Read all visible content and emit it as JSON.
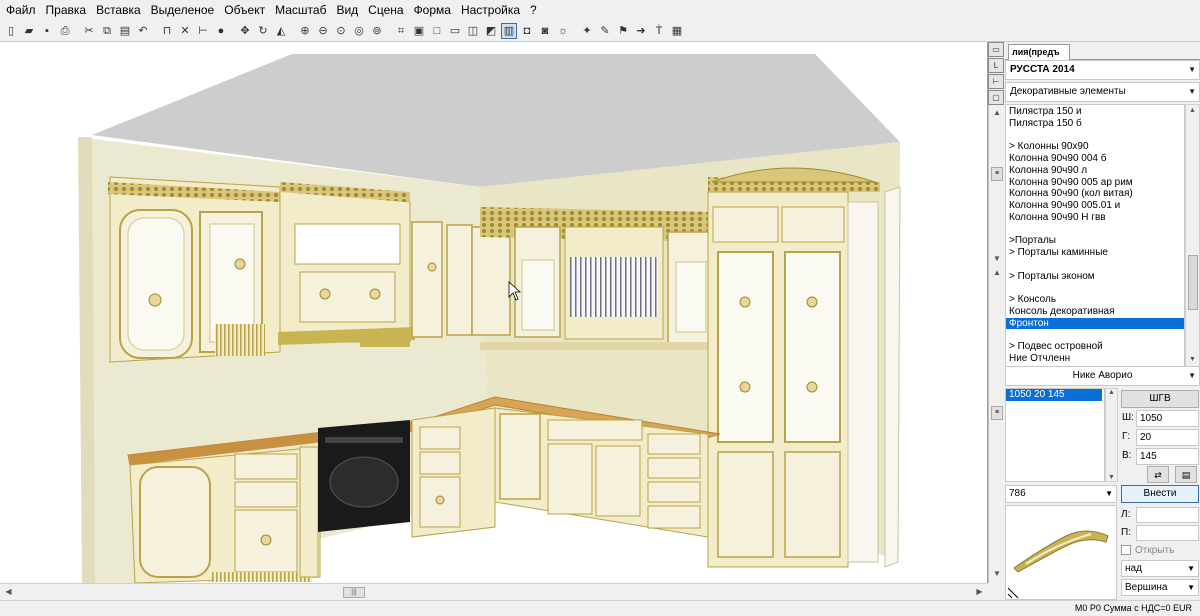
{
  "menu": [
    "Файл",
    "Правка",
    "Вставка",
    "Выделеное",
    "Объект",
    "Масштаб",
    "Вид",
    "Сцена",
    "Форма",
    "Настройка",
    "?"
  ],
  "toolbar": [
    {
      "icon": "new-icon",
      "glyph": "▯"
    },
    {
      "icon": "open-icon",
      "glyph": "▰"
    },
    {
      "icon": "save-icon",
      "glyph": "▪"
    },
    {
      "icon": "print-icon",
      "glyph": "⎙"
    },
    {
      "sep": true
    },
    {
      "icon": "cut-icon",
      "glyph": "✂"
    },
    {
      "icon": "copy-icon",
      "glyph": "⧉"
    },
    {
      "icon": "paste-icon",
      "glyph": "▤"
    },
    {
      "icon": "undo-icon",
      "glyph": "↶"
    },
    {
      "sep": true
    },
    {
      "icon": "snap-icon",
      "glyph": "⊓"
    },
    {
      "icon": "pin-icon",
      "glyph": "✕"
    },
    {
      "icon": "dimension-icon",
      "glyph": "⊢"
    },
    {
      "icon": "info-icon",
      "glyph": "●"
    },
    {
      "sep": true
    },
    {
      "icon": "move-icon",
      "glyph": "✥"
    },
    {
      "icon": "rotate-icon",
      "glyph": "↻"
    },
    {
      "icon": "mirror-icon",
      "glyph": "◭"
    },
    {
      "sep": true
    },
    {
      "icon": "zoom-in-icon",
      "glyph": "⊕"
    },
    {
      "icon": "zoom-out-icon",
      "glyph": "⊖"
    },
    {
      "icon": "zoom-window-icon",
      "glyph": "⊙"
    },
    {
      "icon": "zoom-all-icon",
      "glyph": "◎"
    },
    {
      "icon": "zoom-prev-icon",
      "glyph": "⊚"
    },
    {
      "sep": true
    },
    {
      "icon": "plan-view-icon",
      "glyph": "⌗"
    },
    {
      "icon": "front-view-icon",
      "glyph": "▣"
    },
    {
      "icon": "wireframe-icon",
      "glyph": "□"
    },
    {
      "icon": "box-icon",
      "glyph": "▭"
    },
    {
      "icon": "cube-icon",
      "glyph": "◫"
    },
    {
      "icon": "render-icon",
      "glyph": "◩"
    },
    {
      "icon": "shaded-icon",
      "glyph": "▥",
      "active": true
    },
    {
      "icon": "camera-icon",
      "glyph": "◘"
    },
    {
      "icon": "photo-icon",
      "glyph": "◙"
    },
    {
      "icon": "light-icon",
      "glyph": "☼"
    },
    {
      "sep": true
    },
    {
      "icon": "wand-icon",
      "glyph": "✦"
    },
    {
      "icon": "brush-icon",
      "glyph": "✎"
    },
    {
      "icon": "flag-icon",
      "glyph": "⚑"
    },
    {
      "icon": "walk-icon",
      "glyph": "➜"
    },
    {
      "icon": "text-icon",
      "glyph": "Ṫ"
    },
    {
      "icon": "report-icon",
      "glyph": "▦"
    }
  ],
  "panel": {
    "tab_label": "лия(предъ",
    "side_tabs": [
      "▭",
      "L",
      "⊢",
      "▢"
    ],
    "catalog_combo": "РУССТА 2014",
    "category_combo": "Декоративные элементы",
    "catalog_items": [
      {
        "text": "Пилястра 150 и"
      },
      {
        "text": "Пилястра  150 б"
      },
      {
        "text": ""
      },
      {
        "text": "> Колонны 90х90"
      },
      {
        "text": "Колонна 90ч90 004 б"
      },
      {
        "text": "Колонна 90ч90  л"
      },
      {
        "text": "Колонна 90ч90  005 ар рим"
      },
      {
        "text": "Колонна 90ч90  (кол витая)"
      },
      {
        "text": "Колонна 90ч90 005.01 и"
      },
      {
        "text": "Колонна 90ч90 Н гвв"
      },
      {
        "text": ""
      },
      {
        "text": ">Порталы"
      },
      {
        "text": "> Порталы каминные"
      },
      {
        "text": ""
      },
      {
        "text": "> Порталы эконом"
      },
      {
        "text": ""
      },
      {
        "text": "> Консоль"
      },
      {
        "text": "Консоль декоративная"
      },
      {
        "text": "Фронтон",
        "selected": true
      },
      {
        "text": ""
      },
      {
        "text": "> Подвес островной"
      },
      {
        "text": "Ние Отчленн"
      }
    ],
    "material_combo": "Нике Аворио",
    "size_items": [
      {
        "text": "1050  20  145",
        "selected": true
      }
    ],
    "sgv_button": "ШГВ",
    "w_label": "Ш:",
    "w_value": "1050",
    "d_label": "Г:",
    "d_value": "20",
    "h_label": "В:",
    "h_value": "145",
    "article_combo": "786",
    "insert_button": "Внести",
    "l_label": "Л:",
    "p_label": "П:",
    "open_label": "Открыть",
    "position_combo": "над",
    "anchor_combo": "Вершина"
  },
  "status": "М0  Р0 Сумма с НДС=0 EUR",
  "colors": {
    "wall": "#ebe9cf",
    "ceiling": "#cdcdcd",
    "floor": "#ffffff",
    "cabinet": "#f3eccb",
    "gold": "#b9a346",
    "countertop": "#d8a556",
    "oven": "#1a1a1a",
    "selection": "#0a6fd6"
  }
}
